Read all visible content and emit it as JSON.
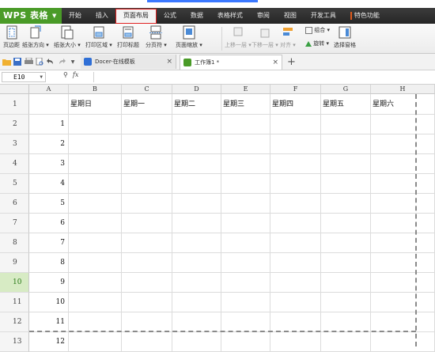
{
  "app": {
    "brand": "WPS 表格",
    "menu": [
      "开始",
      "插入",
      "页面布局",
      "公式",
      "数据",
      "表格样式",
      "审阅",
      "视图",
      "开发工具",
      "特色功能"
    ],
    "active_menu": "页面布局"
  },
  "ribbon": {
    "buttons": [
      {
        "label": "页边距",
        "icon": "margins-icon"
      },
      {
        "label": "纸张方向 ▾",
        "icon": "orientation-icon"
      },
      {
        "label": "纸张大小 ▾",
        "icon": "paper-size-icon"
      },
      {
        "label": "打印区域 ▾",
        "icon": "print-area-icon"
      },
      {
        "label": "打印标题",
        "icon": "print-titles-icon"
      },
      {
        "label": "分页符 ▾",
        "icon": "page-break-icon"
      },
      {
        "label": "页面缩放 ▾",
        "icon": "page-zoom-icon"
      },
      {
        "label": "上移一层 ▾",
        "icon": "bring-forward-icon"
      },
      {
        "label": "下移一层 ▾",
        "icon": "send-backward-icon"
      },
      {
        "label": "对齐 ▾",
        "icon": "align-icon"
      },
      {
        "label": "组合 ▾",
        "icon": "group-icon"
      },
      {
        "label": "旋转 ▾",
        "icon": "rotate-icon"
      },
      {
        "label": "选择窗格",
        "icon": "selection-pane-icon"
      }
    ]
  },
  "tabs": [
    {
      "label": "Docer-在线模板"
    },
    {
      "label": "工作簿1 *"
    }
  ],
  "namebox": "E10",
  "fx": "fx",
  "columns": [
    "A",
    "B",
    "C",
    "D",
    "E",
    "F",
    "G",
    "H"
  ],
  "headers_row": [
    "",
    "星期日",
    "星期一",
    "星期二",
    "星期三",
    "星期四",
    "星期五",
    "星期六"
  ],
  "rows": [
    {
      "num": "1"
    },
    {
      "num": "2",
      "a": "1"
    },
    {
      "num": "3",
      "a": "2"
    },
    {
      "num": "4",
      "a": "3"
    },
    {
      "num": "5",
      "a": "4"
    },
    {
      "num": "6",
      "a": "5"
    },
    {
      "num": "7",
      "a": "6"
    },
    {
      "num": "8",
      "a": "7"
    },
    {
      "num": "9",
      "a": "8"
    },
    {
      "num": "10",
      "a": "9"
    },
    {
      "num": "11",
      "a": "10"
    },
    {
      "num": "12",
      "a": "11"
    },
    {
      "num": "13",
      "a": "12"
    }
  ],
  "colors": {
    "brand_green": "#4a9b28",
    "active_border": "#e02020",
    "selected_row": "#d7ebc4"
  }
}
